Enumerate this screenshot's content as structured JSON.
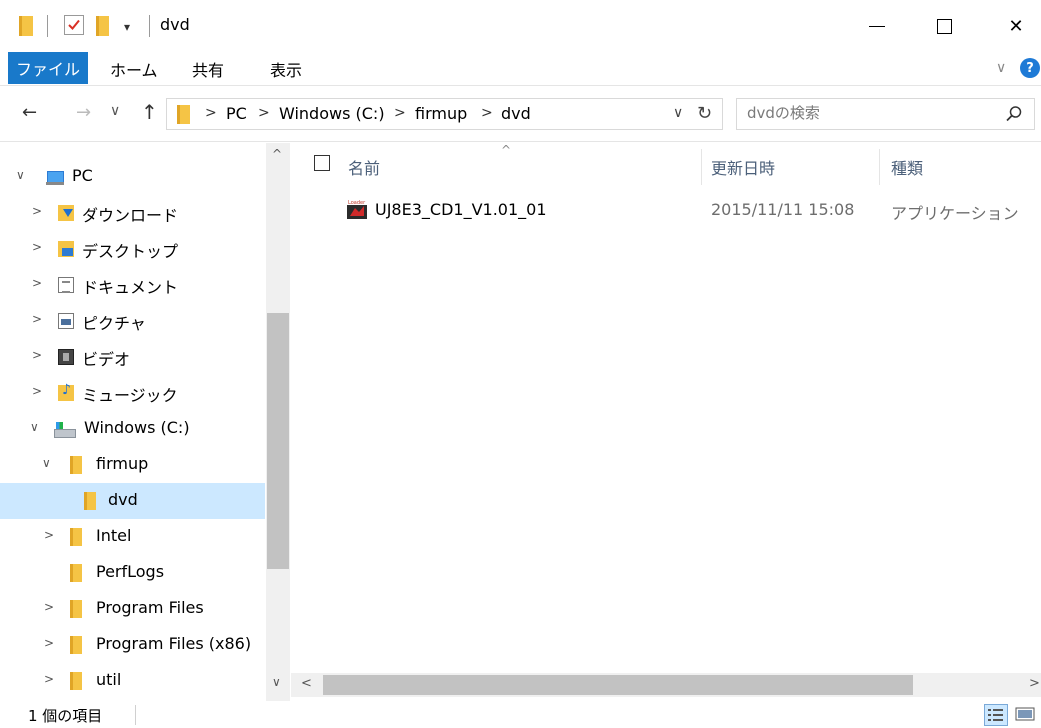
{
  "window": {
    "title": "dvd",
    "quick_access_dropdown": "▾",
    "minimize_label": "",
    "close_glyph": "✕"
  },
  "ribbon": {
    "tabs": {
      "file": "ファイル",
      "home": "ホーム",
      "share": "共有",
      "view": "表示"
    },
    "expand_glyph": "∨",
    "help_glyph": "?"
  },
  "address": {
    "back_glyph": "←",
    "forward_glyph": "→",
    "recent_glyph": "∨",
    "up_glyph": "↑",
    "separator_glyph": ">",
    "crumbs": [
      "PC",
      "Windows (C:)",
      "firmup",
      "dvd"
    ],
    "dropdown_glyph": "∨",
    "refresh_glyph": "↻"
  },
  "search": {
    "placeholder": "dvdの検索"
  },
  "nav_pane": {
    "collapse_glyph": "∨",
    "expand_glyph": ">",
    "items": [
      {
        "label": "PC",
        "state": "expanded"
      },
      {
        "label": "ダウンロード",
        "state": "collapsed"
      },
      {
        "label": "デスクトップ",
        "state": "collapsed"
      },
      {
        "label": "ドキュメント",
        "state": "collapsed"
      },
      {
        "label": "ピクチャ",
        "state": "collapsed"
      },
      {
        "label": "ビデオ",
        "state": "collapsed"
      },
      {
        "label": "ミュージック",
        "state": "collapsed"
      },
      {
        "label": "Windows (C:)",
        "state": "expanded"
      },
      {
        "label": "firmup",
        "state": "expanded"
      },
      {
        "label": "dvd",
        "state": "selected"
      },
      {
        "label": "Intel",
        "state": "collapsed"
      },
      {
        "label": "PerfLogs",
        "state": "none"
      },
      {
        "label": "Program Files",
        "state": "collapsed"
      },
      {
        "label": "Program Files (x86)",
        "state": "collapsed"
      },
      {
        "label": "util",
        "state": "collapsed"
      }
    ],
    "scroll_up_glyph": "^",
    "scroll_down_glyph": "∨"
  },
  "file_list": {
    "sort_caret": "^",
    "columns": {
      "name": "名前",
      "date": "更新日時",
      "type": "種類"
    },
    "rows": [
      {
        "name": "UJ8E3_CD1_V1.01_01",
        "date": "2015/11/11 15:08",
        "type": "アプリケーション"
      }
    ],
    "scroll_left_glyph": "<",
    "scroll_right_glyph": ">"
  },
  "status": {
    "item_count": "1 個の項目"
  },
  "colors": {
    "accent": "#1979ca",
    "selected_bg": "#cce8ff",
    "folder": "#f5c445",
    "header_text": "#4c607a"
  }
}
